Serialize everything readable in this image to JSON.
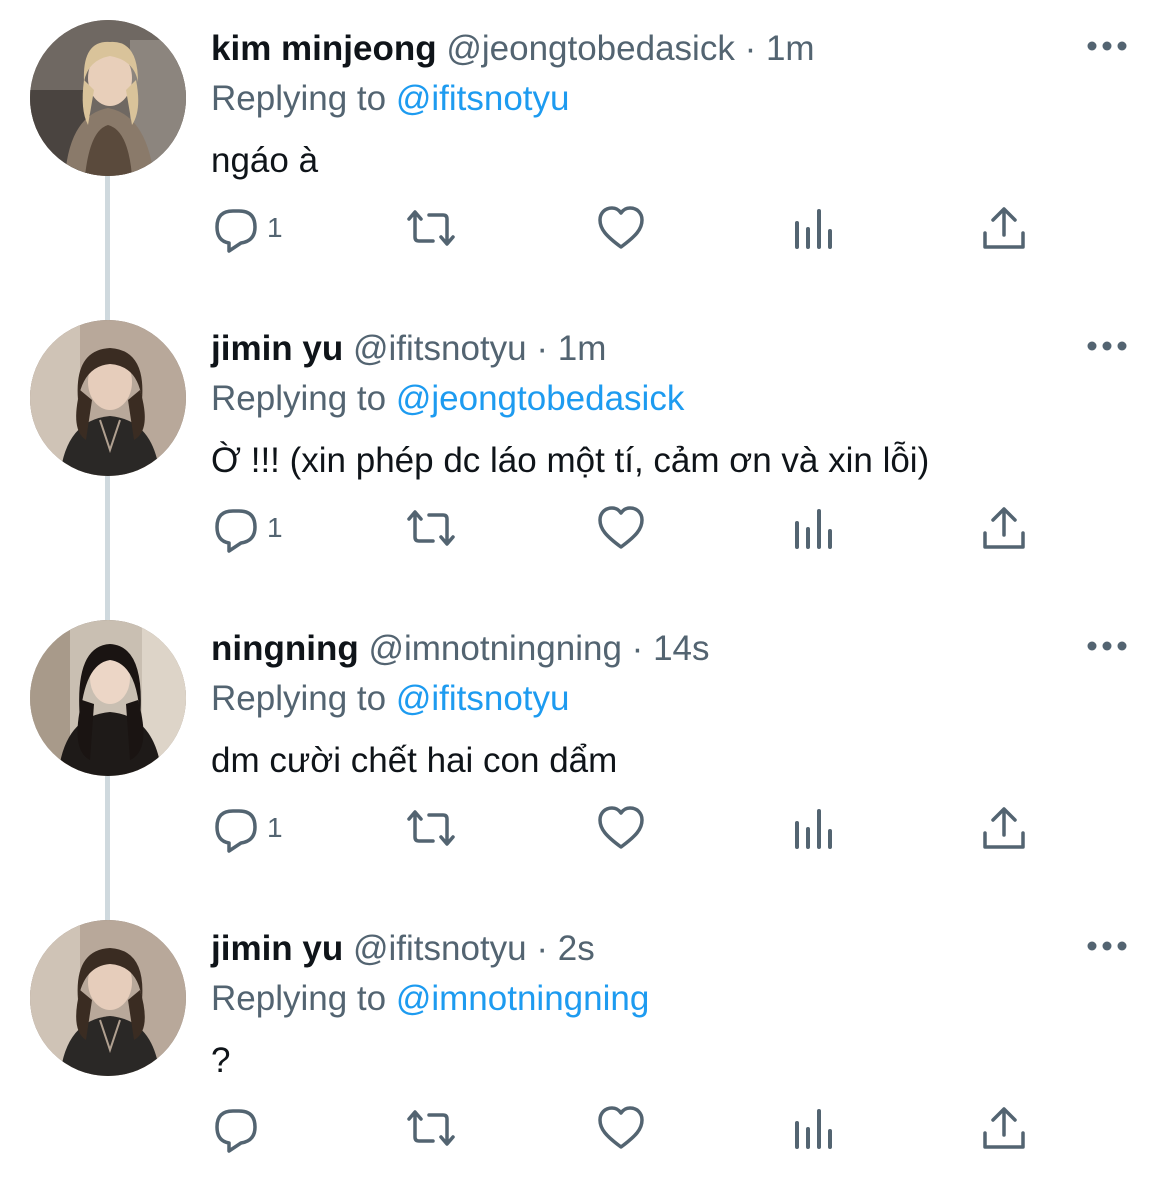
{
  "tweets": [
    {
      "name": "kim minjeong",
      "handle": "@jeongtobedasick",
      "time": "1m",
      "replying_prefix": "Replying to",
      "replying_to": "@ifitsnotyu",
      "text": "ngáo à",
      "reply_count": "1"
    },
    {
      "name": "jimin yu",
      "handle": "@ifitsnotyu",
      "time": "1m",
      "replying_prefix": "Replying to",
      "replying_to": "@jeongtobedasick",
      "text": "Ờ !!! (xin phép dc láo một tí, cảm ơn và xin lỗi)",
      "reply_count": "1"
    },
    {
      "name": "ningning",
      "handle": "@imnotningning",
      "time": "14s",
      "replying_prefix": "Replying to",
      "replying_to": "@ifitsnotyu",
      "text": "dm cười chết hai con dẩm",
      "reply_count": "1"
    },
    {
      "name": "jimin yu",
      "handle": "@ifitsnotyu",
      "time": "2s",
      "replying_prefix": "Replying to",
      "replying_to": "@imnotningning",
      "text": "?",
      "reply_count": ""
    }
  ],
  "separator": "·",
  "icons": {
    "more": "more-horizontal-icon",
    "reply": "reply-bubble-icon",
    "retweet": "retweet-icon",
    "like": "heart-icon",
    "views": "views-bar-chart-icon",
    "share": "share-upload-icon"
  },
  "colors": {
    "text": "#0f1419",
    "secondary": "#536471",
    "link": "#1d9bf0",
    "thread_line": "#cfd9de"
  }
}
